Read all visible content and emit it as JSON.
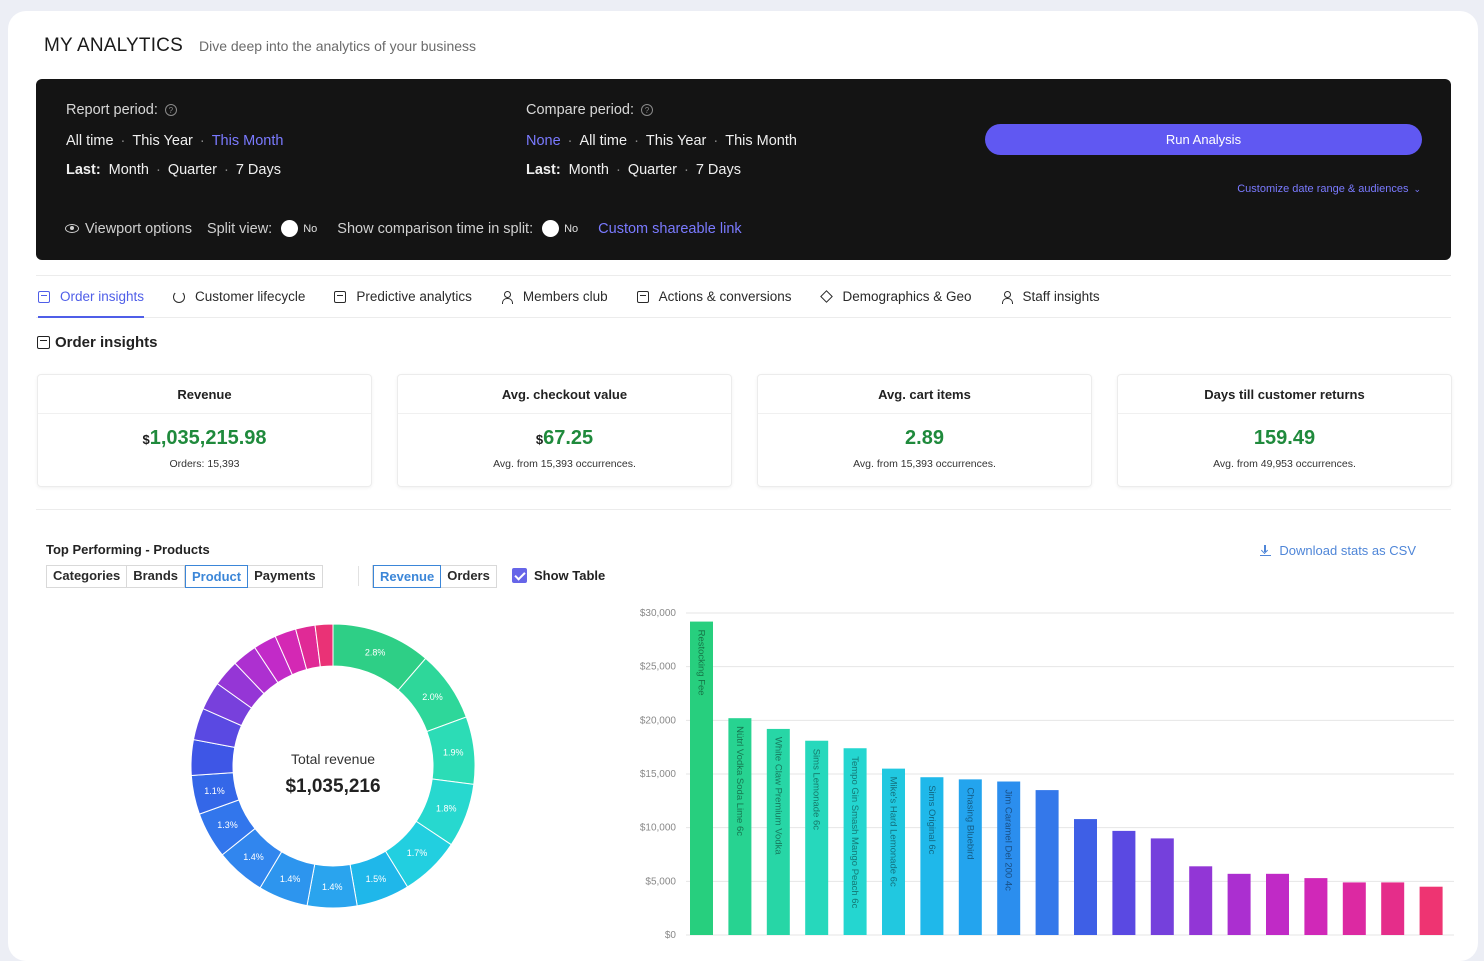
{
  "header": {
    "title": "MY ANALYTICS",
    "subtitle": "Dive deep into the analytics of your business"
  },
  "report": {
    "label": "Report period:",
    "options": [
      "All time",
      "This Year",
      "This Month"
    ],
    "active": "This Month",
    "last_label": "Last:",
    "last_options": [
      "Month",
      "Quarter",
      "7 Days"
    ]
  },
  "compare": {
    "label": "Compare period:",
    "options": [
      "None",
      "All time",
      "This Year",
      "This Month"
    ],
    "active": "None",
    "last_label": "Last:",
    "last_options": [
      "Month",
      "Quarter",
      "7 Days"
    ]
  },
  "run_label": "Run Analysis",
  "customize_label": "Customize date range & audiences",
  "viewport": {
    "label": "Viewport options",
    "split_label": "Split view:",
    "split_value": "No",
    "comparison_label": "Show comparison time in split:",
    "comparison_value": "No",
    "share_label": "Custom shareable link"
  },
  "tabs": [
    {
      "label": "Order insights",
      "icon": "order-icon"
    },
    {
      "label": "Customer lifecycle",
      "icon": "refresh-icon"
    },
    {
      "label": "Predictive analytics",
      "icon": "document-icon"
    },
    {
      "label": "Members club",
      "icon": "people-icon"
    },
    {
      "label": "Actions & conversions",
      "icon": "box-icon"
    },
    {
      "label": "Demographics & Geo",
      "icon": "pin-icon"
    },
    {
      "label": "Staff insights",
      "icon": "person-icon"
    }
  ],
  "active_tab": "Order insights",
  "section_title": "Order insights",
  "kpis": [
    {
      "title": "Revenue",
      "currency": "$",
      "value": "1,035,215.98",
      "sub": "Orders: 15,393"
    },
    {
      "title": "Avg. checkout value",
      "currency": "$",
      "value": "67.25",
      "sub": "Avg. from 15,393 occurrences."
    },
    {
      "title": "Avg. cart items",
      "currency": "",
      "value": "2.89",
      "sub": "Avg. from 15,393 occurrences."
    },
    {
      "title": "Days till customer returns",
      "currency": "",
      "value": "159.49",
      "sub": "Avg. from 49,953 occurrences."
    }
  ],
  "top_performing": {
    "title": "Top Performing - Products",
    "group_options": [
      "Categories",
      "Brands",
      "Product",
      "Payments"
    ],
    "group_selected": "Product",
    "metric_options": [
      "Revenue",
      "Orders"
    ],
    "metric_selected": "Revenue",
    "show_table_label": "Show Table",
    "show_table": true,
    "download_label": "Download stats as CSV"
  },
  "chart_data": [
    {
      "type": "pie",
      "title": "Total revenue",
      "center_value": "$1,035,216",
      "labeled_slices": [
        {
          "label": "2.8%",
          "value": 2.8,
          "color": "#2ecf86"
        },
        {
          "label": "2.0%",
          "value": 2.0,
          "color": "#2ed79a"
        },
        {
          "label": "1.9%",
          "value": 1.9,
          "color": "#2cdcb6"
        },
        {
          "label": "1.8%",
          "value": 1.8,
          "color": "#27d8cf"
        },
        {
          "label": "1.7%",
          "value": 1.7,
          "color": "#22cfe0"
        },
        {
          "label": "1.5%",
          "value": 1.5,
          "color": "#1fb7ea"
        },
        {
          "label": "1.4%",
          "value": 1.4,
          "color": "#2aa4ee"
        },
        {
          "label": "1.4%",
          "value": 1.4,
          "color": "#2d95ee"
        },
        {
          "label": "1.4%",
          "value": 1.4,
          "color": "#3186ee"
        },
        {
          "label": "1.3%",
          "value": 1.3,
          "color": "#3276ec"
        },
        {
          "label": "1.1%",
          "value": 1.1,
          "color": "#3467e8"
        }
      ],
      "unlabeled_slices": [
        {
          "value": 1.0,
          "color": "#3e56e6"
        },
        {
          "value": 0.9,
          "color": "#5a49e2"
        },
        {
          "value": 0.8,
          "color": "#7840dc"
        },
        {
          "value": 0.75,
          "color": "#9536d6"
        },
        {
          "value": 0.7,
          "color": "#ad30d0"
        },
        {
          "value": 0.65,
          "color": "#c22ac8"
        },
        {
          "value": 0.6,
          "color": "#d428b4"
        },
        {
          "value": 0.55,
          "color": "#e02a96"
        },
        {
          "value": 0.5,
          "color": "#ea3276"
        }
      ]
    },
    {
      "type": "bar",
      "ylim": [
        0,
        30000
      ],
      "yticks": [
        "$0",
        "$5,000",
        "$10,000",
        "$15,000",
        "$20,000",
        "$25,000",
        "$30,000"
      ],
      "ytick_values": [
        0,
        5000,
        10000,
        15000,
        20000,
        25000,
        30000
      ],
      "grid": true,
      "categories": [
        "Restocking Fee",
        "Nütrl Vodka Soda Lime 6c",
        "White Claw Premium Vodka",
        "Sims Lemonade 6c",
        "Tempo Gin Smash Mango Peach 6c",
        "Mike's Hard Lemonade 6c",
        "Sims Original 6c",
        "Chasing Bluebird",
        "Jim Caramel Del 200 4c",
        "",
        "",
        "",
        "",
        "",
        "",
        "",
        "",
        "",
        "",
        ""
      ],
      "values": [
        29200,
        20200,
        19200,
        18100,
        17400,
        15500,
        14700,
        14500,
        14300,
        13500,
        10800,
        9700,
        9000,
        6400,
        5700,
        5700,
        5300,
        4900,
        4900,
        4500
      ],
      "colors": [
        "#27cf7e",
        "#27d391",
        "#27d6a6",
        "#26d8bc",
        "#24d6d0",
        "#21c8e0",
        "#1fb8ea",
        "#23a4ee",
        "#2b8eee",
        "#3478ea",
        "#3e5fe6",
        "#5a49e2",
        "#7540dc",
        "#9236d6",
        "#ab2fd0",
        "#c02ac6",
        "#d028b8",
        "#dc29a2",
        "#e52d8a",
        "#ee3472"
      ]
    }
  ]
}
